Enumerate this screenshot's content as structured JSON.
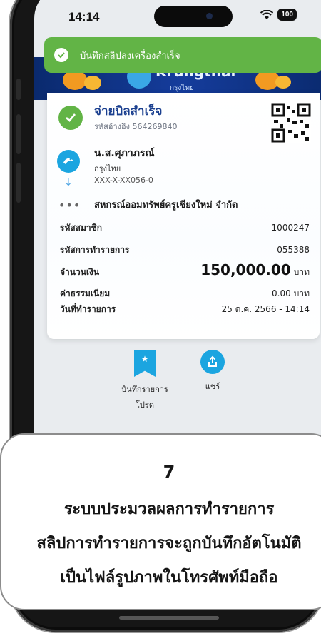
{
  "status_bar": {
    "time": "14:14",
    "battery": "100"
  },
  "toast": {
    "text": "บันทึกสลิปลงเครื่องสำเร็จ"
  },
  "banner": {
    "brand": "Krungthai",
    "brand_sub": "กรุงไทย"
  },
  "receipt": {
    "title": "จ่ายบิลสำเร็จ",
    "reference": "รหัสอ้างอิง 564269840",
    "recipient_name": "น.ส.ศุภาภรณ์",
    "recipient_bank": "กรุงไทย",
    "recipient_account": "XXX-X-XX056-0",
    "payee": "สหกรณ์ออมทรัพย์ครูเชียงใหม่ จำกัด",
    "rows": [
      {
        "label": "รหัสสมาชิก",
        "value": "1000247",
        "unit": ""
      },
      {
        "label": "รหัสการทำรายการ",
        "value": "055388",
        "unit": ""
      },
      {
        "label": "จำนวนเงิน",
        "value": "150,000.00",
        "unit": "บาท"
      },
      {
        "label": "ค่าธรรมเนียม",
        "value": "0.00",
        "unit": "บาท"
      },
      {
        "label": "วันที่ทำรายการ",
        "value": "25 ต.ค. 2566 - 14:14",
        "unit": ""
      }
    ]
  },
  "actions": {
    "favorite_label_1": "บันทึกรายการ",
    "favorite_label_2": "โปรด",
    "share_label": "แชร์"
  },
  "caption": {
    "step": "7",
    "line1": "ระบบประมวลผลการทำรายการ",
    "line2": "สลิปการทำรายการจะถูกบันทึกอัตโนมัติ",
    "line3": "เป็นไฟล์รูปภาพในโทรศัพท์มือถือ"
  }
}
